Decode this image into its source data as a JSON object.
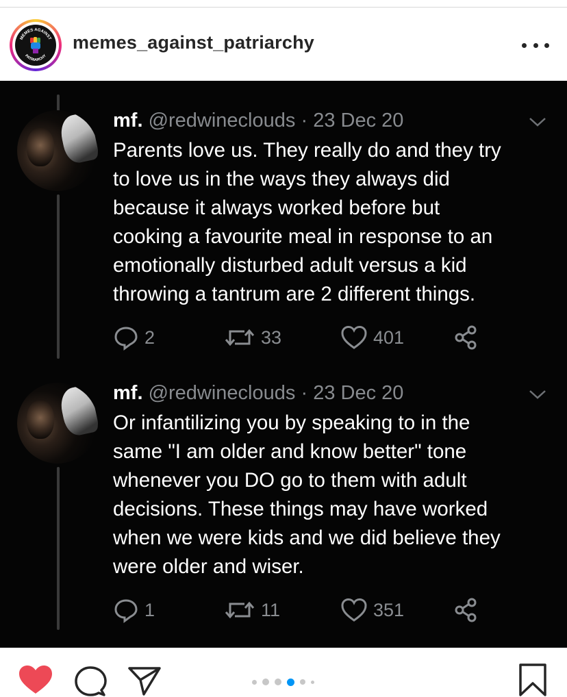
{
  "post": {
    "username": "memes_against_patriarchy",
    "avatar_text_top": "MEMES AGAINST",
    "avatar_text_bottom": "PATRIARCHY"
  },
  "tweets": [
    {
      "name": "mf.",
      "handle": "@redwineclouds",
      "date": "23 Dec 20",
      "lines": [
        "Parents love us. They really do and they try",
        "to love us in the ways they always did",
        "because it always worked before but",
        "cooking a favourite meal in response to an",
        "emotionally disturbed adult versus a kid",
        "throwing a tantrum are 2 different things."
      ],
      "replies": "2",
      "retweets": "33",
      "likes": "401"
    },
    {
      "name": "mf.",
      "handle": "@redwineclouds",
      "date": "23 Dec 20",
      "lines": [
        "Or infantilizing you by speaking to in the",
        "same \"I am older and know better\" tone",
        "whenever you DO go to them with adult",
        "decisions. These things may have worked",
        "when we were kids and we did believe they",
        "were older and wiser."
      ],
      "replies": "1",
      "retweets": "11",
      "likes": "351"
    }
  ],
  "carousel": {
    "count": 6,
    "active_index": 3
  },
  "icons": {
    "like": "heart-icon",
    "comment": "comment-icon",
    "share": "send-icon",
    "save": "bookmark-icon",
    "more": "more-icon"
  },
  "colors": {
    "like_active": "#ed4956",
    "carousel_active": "#0095f6",
    "tweet_bg": "#050505",
    "tweet_meta": "#8a8d91"
  }
}
